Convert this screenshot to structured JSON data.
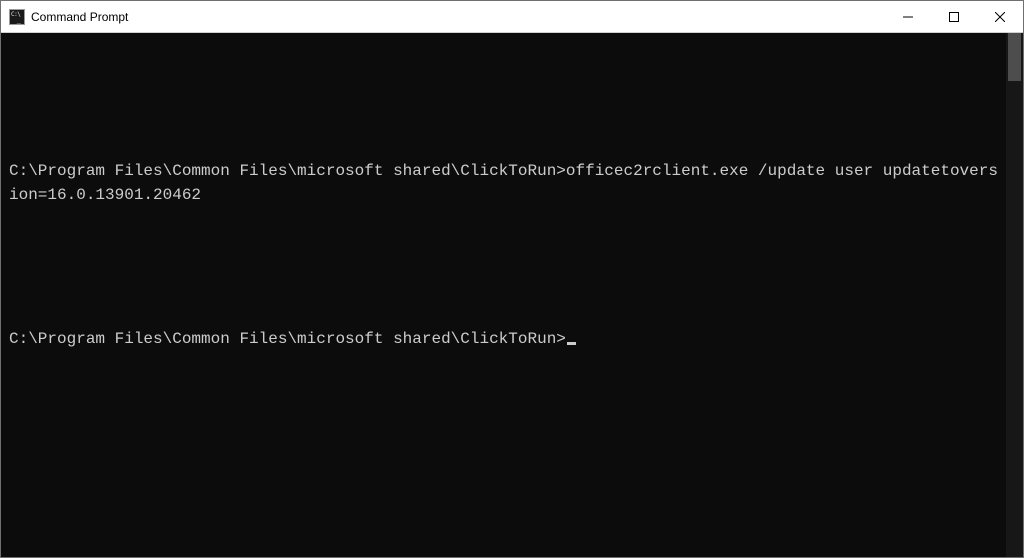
{
  "window": {
    "title": "Command Prompt"
  },
  "console": {
    "line1_prompt": "C:\\Program Files\\Common Files\\microsoft shared\\ClickToRun>",
    "line1_command": "officec2rclient.exe /update user updatetoversion=16.0.13901.20462",
    "line2_prompt": "C:\\Program Files\\Common Files\\microsoft shared\\ClickToRun>"
  }
}
